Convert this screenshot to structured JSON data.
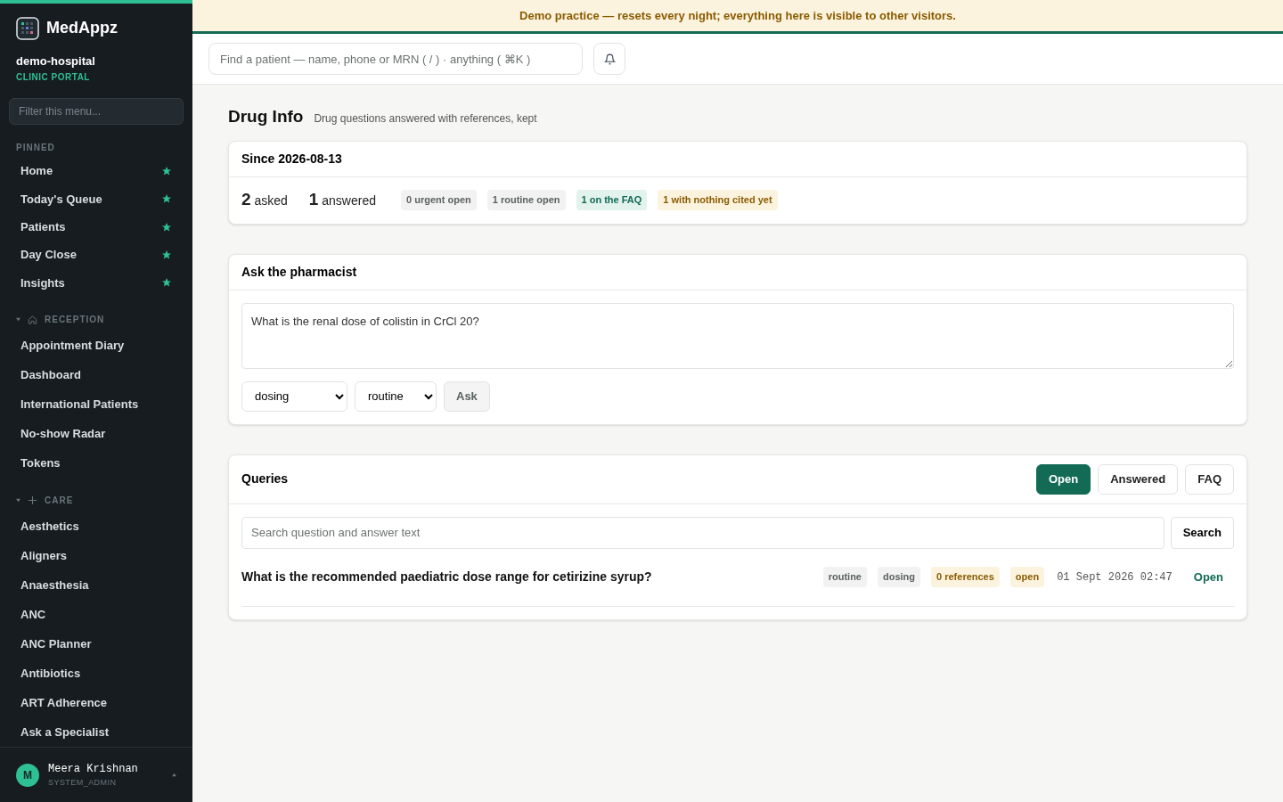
{
  "sidebar": {
    "brand": "MedAppz",
    "org": "demo-hospital",
    "portal": "CLINIC PORTAL",
    "filter_placeholder": "Filter this menu...",
    "pinned": {
      "title": "PINNED",
      "items": [
        {
          "label": "Home",
          "starred": true
        },
        {
          "label": "Today's Queue",
          "starred": true
        },
        {
          "label": "Patients",
          "starred": true
        },
        {
          "label": "Day Close",
          "starred": true
        },
        {
          "label": "Insights",
          "starred": true
        }
      ]
    },
    "groups": [
      {
        "title": "RECEPTION",
        "kind": "house",
        "expanded": true,
        "items": [
          "Appointment Diary",
          "Dashboard",
          "International Patients",
          "No-show Radar",
          "Tokens"
        ]
      },
      {
        "title": "CARE",
        "kind": "plus",
        "expanded": true,
        "items": [
          "Aesthetics",
          "Aligners",
          "Anaesthesia",
          "ANC",
          "ANC Planner",
          "Antibiotics",
          "ART Adherence",
          "Ask a Specialist"
        ]
      }
    ],
    "user": {
      "initial": "M",
      "name": "Meera Krishnan",
      "role": "SYSTEM_ADMIN"
    }
  },
  "banner": "Demo practice — resets every night; everything here is visible to other visitors.",
  "search": {
    "placeholder": "Find a patient — name, phone or MRN ( / ) · anything ( ⌘K )"
  },
  "page": {
    "title": "Drug Info",
    "subtitle": "Drug questions answered with references, kept"
  },
  "summary": {
    "title": "Since 2026-08-13",
    "stats": [
      "**2** asked",
      "**1** answered"
    ],
    "chips": [
      {
        "label": "0 urgent open",
        "kind": "neutral"
      },
      {
        "label": "1 routine open",
        "kind": "neutral"
      },
      {
        "label": "1 on the FAQ",
        "kind": "green"
      },
      {
        "label": "1 with nothing cited yet",
        "kind": "amber"
      }
    ]
  },
  "ask": {
    "title": "Ask the pharmacist",
    "question": "What is the renal dose of colistin in CrCl 20?",
    "category": "dosing",
    "priority": "routine",
    "button": "Ask"
  },
  "queries": {
    "title": "Queries",
    "tabs": [
      {
        "label": "Open",
        "selected": true
      },
      {
        "label": "Answered",
        "selected": false
      },
      {
        "label": "FAQ",
        "selected": false
      }
    ],
    "search_placeholder": "Search question and answer text",
    "search_button": "Search",
    "rows": [
      {
        "question": "What is the recommended paediatric dose range for cetirizine syrup?",
        "tags": [
          {
            "label": "routine",
            "kind": "neutral"
          },
          {
            "label": "dosing",
            "kind": "neutral"
          },
          {
            "label": "0 references",
            "kind": "amber"
          },
          {
            "label": "open",
            "kind": "amber"
          }
        ],
        "time": "01 Sept 2026 02:47",
        "action": "Open"
      }
    ]
  }
}
